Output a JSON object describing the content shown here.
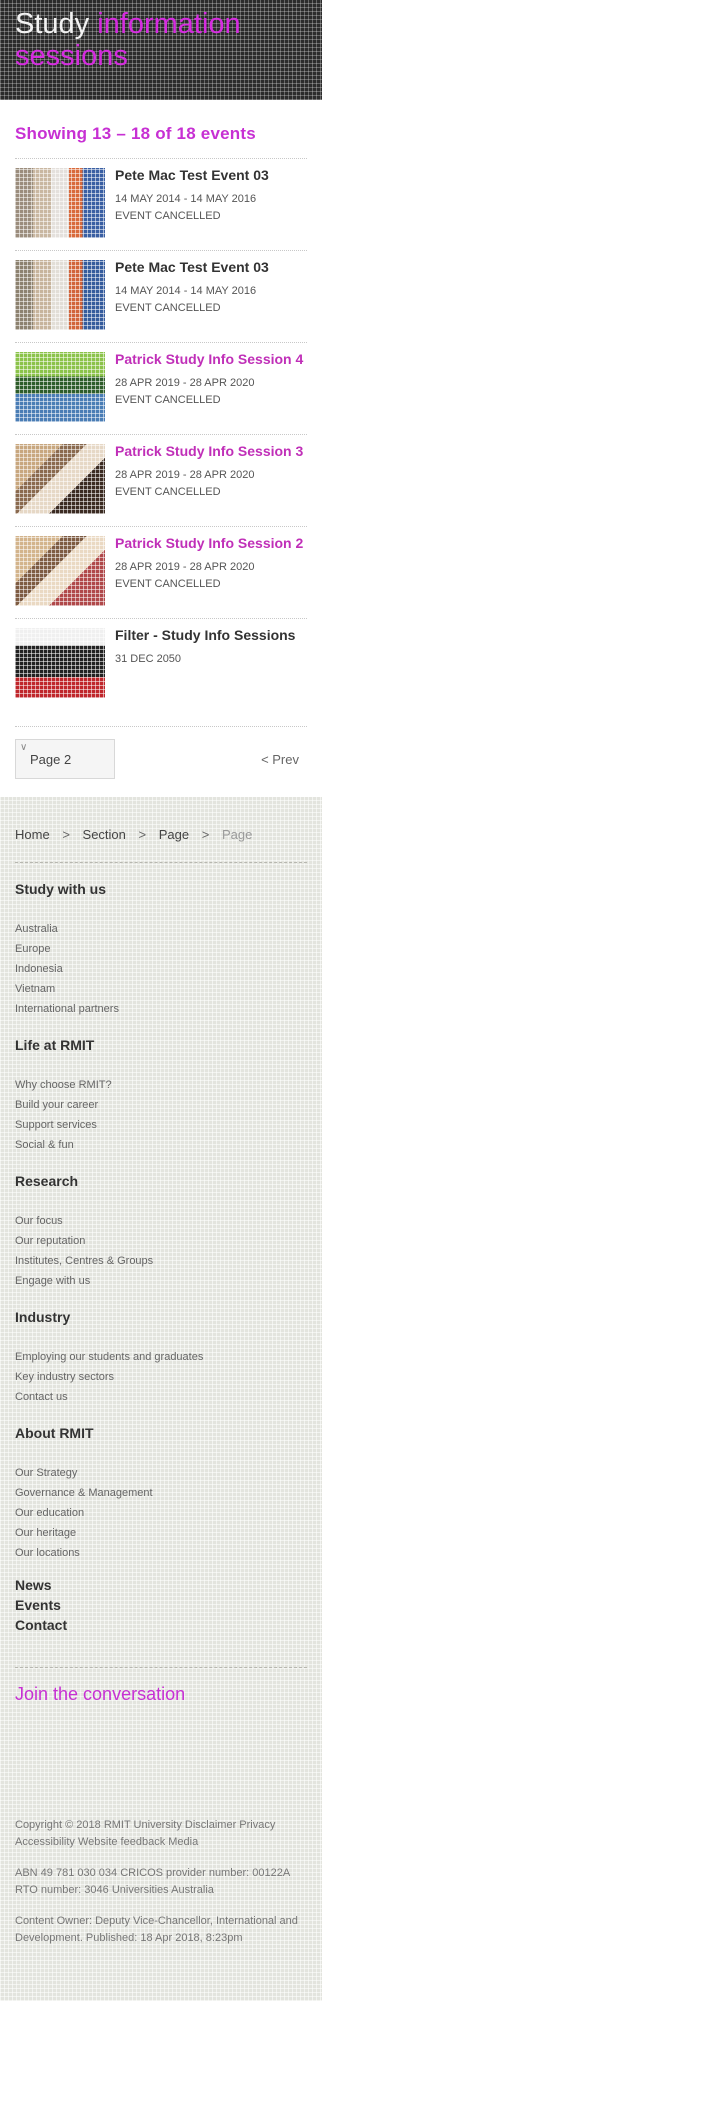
{
  "banner": {
    "title_white": "Study ",
    "title_accent": "information",
    "title_line2": "sessions"
  },
  "listing": {
    "showing": "Showing 13 – 18 of 18 events",
    "events": [
      {
        "title": "Pete Mac Test Event 03",
        "date": "14 MAY 2014 - 14 MAY 2016",
        "status": "EVENT CANCELLED"
      },
      {
        "title": "Pete Mac Test Event 03",
        "date": "14 MAY 2014 - 14 MAY 2016",
        "status": "EVENT CANCELLED"
      },
      {
        "title": "Patrick Study Info Session 4",
        "date": "28 APR 2019 - 28 APR 2020",
        "status": "EVENT CANCELLED"
      },
      {
        "title": "Patrick Study Info Session 3",
        "date": "28 APR 2019 - 28 APR 2020",
        "status": "EVENT CANCELLED"
      },
      {
        "title": "Patrick Study Info Session 2",
        "date": "28 APR 2019 - 28 APR 2020",
        "status": "EVENT CANCELLED"
      },
      {
        "title": "Filter - Study Info Sessions",
        "date": "31 DEC 2050",
        "status": ""
      }
    ]
  },
  "pager": {
    "page_label": "Page 2",
    "prev_label": "< Prev"
  },
  "breadcrumb": {
    "home": "Home",
    "section": "Section",
    "page": "Page",
    "current": "Page",
    "sep": ">"
  },
  "footer": {
    "study": {
      "heading": "Study with us",
      "items": [
        "Australia",
        "Europe",
        "Indonesia",
        "Vietnam",
        "International partners"
      ]
    },
    "life": {
      "heading": "Life at RMIT",
      "items": [
        "Why choose RMIT?",
        "Build your career",
        "Support services",
        "Social & fun"
      ]
    },
    "research": {
      "heading": "Research",
      "items": [
        "Our focus",
        "Our reputation",
        "Institutes, Centres & Groups",
        "Engage with us"
      ]
    },
    "industry": {
      "heading": "Industry",
      "items": [
        "Employing our students and graduates",
        "Key industry sectors",
        "Contact us"
      ]
    },
    "about": {
      "heading": "About RMIT",
      "items": [
        "Our Strategy",
        "Governance & Management",
        "Our education",
        "Our heritage",
        "Our locations"
      ]
    },
    "main_links": [
      "News",
      "Events",
      "Contact"
    ],
    "join": "Join the conversation",
    "legal": {
      "line1": "Copyright © 2018 RMIT University Disclaimer Privacy Accessibility Website feedback Media",
      "line2": "ABN 49 781 030 034 CRICOS provider number: 00122A RTO number: 3046 Universities Australia",
      "line3": "Content Owner: Deputy Vice-Chancellor, International and Development. Published: 18 Apr 2018, 8:23pm"
    }
  }
}
